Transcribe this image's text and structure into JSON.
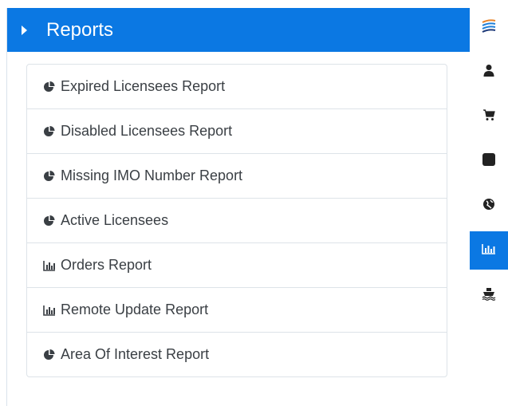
{
  "header": {
    "title": "Reports"
  },
  "reports": [
    {
      "label": "Expired Licensees Report",
      "icon": "pie-chart-icon"
    },
    {
      "label": "Disabled Licensees Report",
      "icon": "pie-chart-icon"
    },
    {
      "label": "Missing IMO Number Report",
      "icon": "pie-chart-icon"
    },
    {
      "label": "Active Licensees",
      "icon": "pie-chart-icon"
    },
    {
      "label": "Orders Report",
      "icon": "bar-chart-icon"
    },
    {
      "label": "Remote Update Report",
      "icon": "bar-chart-icon"
    },
    {
      "label": "Area Of Interest Report",
      "icon": "pie-chart-icon"
    }
  ],
  "rail": [
    {
      "icon": "logo-waves-icon"
    },
    {
      "icon": "user-icon"
    },
    {
      "icon": "cart-icon"
    },
    {
      "icon": "square-icon"
    },
    {
      "icon": "globe-icon"
    },
    {
      "icon": "bar-chart-icon",
      "active": true
    },
    {
      "icon": "ship-icon"
    }
  ],
  "colors": {
    "accent": "#0b78e3",
    "text": "#3a3f44",
    "border": "#dde3e8"
  }
}
